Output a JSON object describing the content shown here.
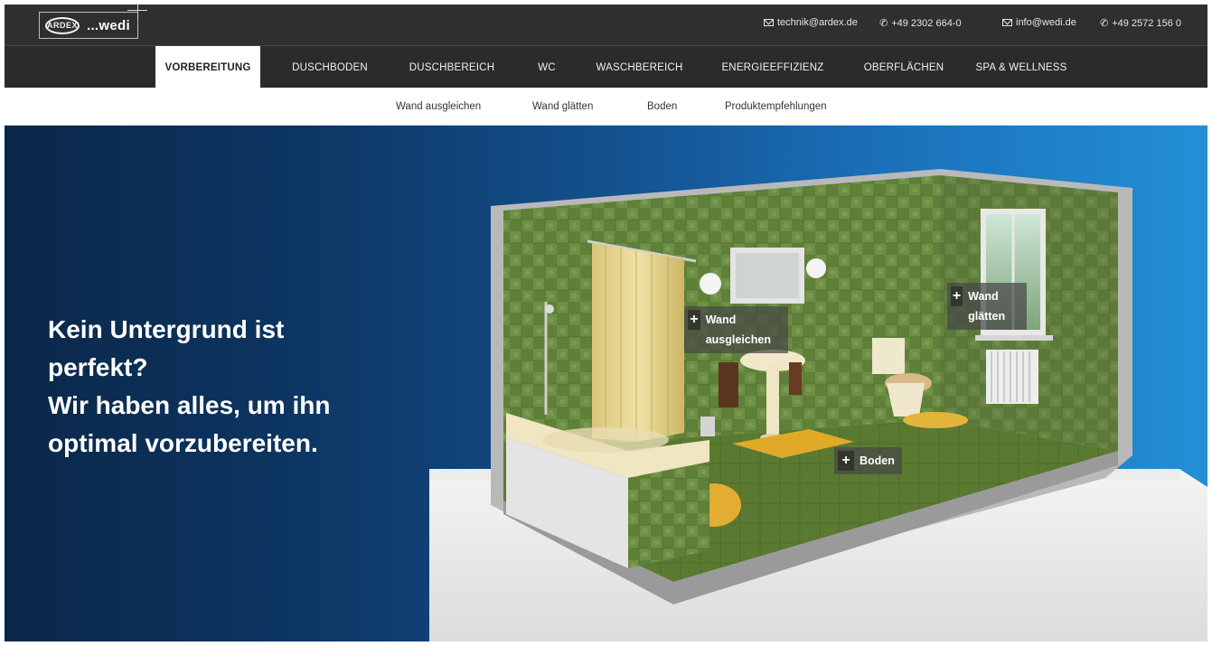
{
  "header": {
    "logo_left": "ARDEX",
    "logo_right": "...wedi",
    "contacts": [
      {
        "type": "email",
        "icon": "mail-icon",
        "text": "technik@ardex.de"
      },
      {
        "type": "phone",
        "icon": "phone-icon",
        "text": "+49 2302 664-0"
      },
      {
        "type": "email",
        "icon": "mail-icon",
        "text": "info@wedi.de"
      },
      {
        "type": "phone",
        "icon": "phone-icon",
        "text": "+49 2572 156 0"
      }
    ]
  },
  "nav": {
    "items": [
      {
        "label": "VORBEREITUNG",
        "active": true
      },
      {
        "label": "DUSCHBODEN",
        "active": false
      },
      {
        "label": "DUSCHBEREICH",
        "active": false
      },
      {
        "label": "WC",
        "active": false
      },
      {
        "label": "WASCHBEREICH",
        "active": false
      },
      {
        "label": "ENERGIEEFFIZIENZ",
        "active": false
      },
      {
        "label": "OBERFLÄCHEN",
        "active": false
      },
      {
        "label": "SPA & WELLNESS",
        "active": false
      }
    ]
  },
  "subnav": {
    "items": [
      "Wand ausgleichen",
      "Wand glätten",
      "Boden",
      "Produktempfehlungen"
    ]
  },
  "hero": {
    "headline_lines": [
      "Kein Untergrund ist",
      "perfekt?",
      "Wir haben alles, um ihn",
      "optimal vorzubereiten."
    ],
    "hotspots": [
      {
        "symbol": "+",
        "label": "Wand ausgleichen"
      },
      {
        "symbol": "+",
        "label": "Wand glätten"
      },
      {
        "symbol": "+",
        "label": "Boden"
      }
    ]
  },
  "colors": {
    "topbar": "#2f2f2f",
    "nav": "#2b2b2b",
    "hero_dark": "#0b2749",
    "hero_light": "#238fd6",
    "tile_green": "#5e7f3a"
  }
}
